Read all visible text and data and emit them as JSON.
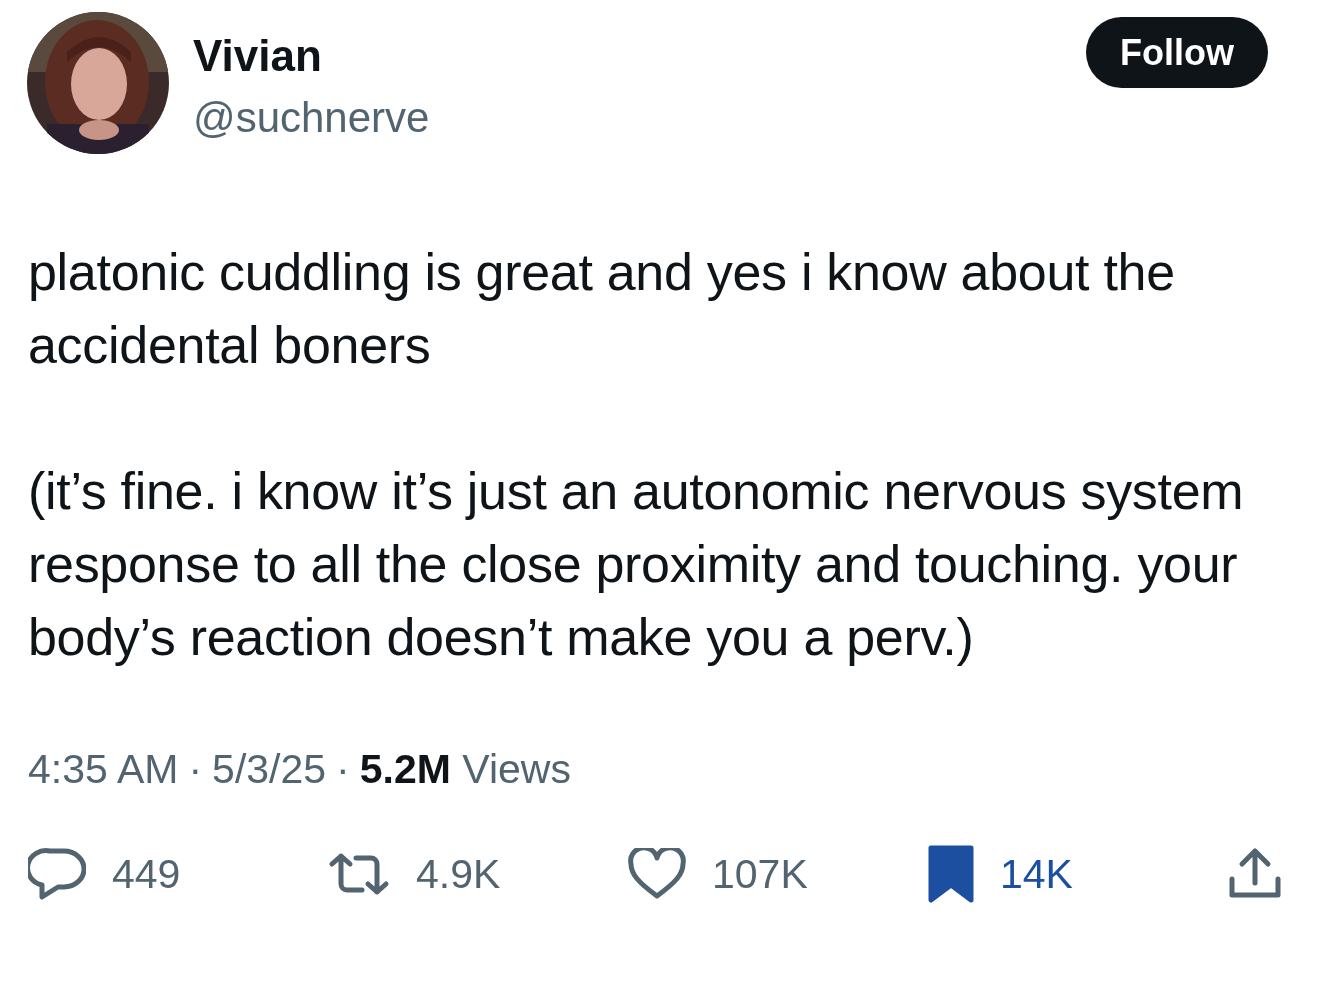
{
  "author": {
    "name": "Vivian",
    "handle": "@suchnerve"
  },
  "follow_button": {
    "label": "Follow"
  },
  "post": {
    "paragraphs": [
      "platonic cuddling is great and yes i know about the accidental boners",
      "(it’s fine. i know it’s just an autonomic nervous system response to all the close proximity and touching. your body’s reaction doesn’t make you a perv.)"
    ]
  },
  "meta": {
    "time": "4:35 AM",
    "separator_1": "·",
    "date": "5/3/25",
    "separator_2": "·",
    "views": "**5.2M** Views"
  },
  "actions": [
    {
      "kind": "reply",
      "count": "449",
      "selected": false
    },
    {
      "kind": "repost",
      "count": "4.9K",
      "selected": false
    },
    {
      "kind": "like",
      "count": "107K",
      "selected": false
    },
    {
      "kind": "bookmark",
      "count": "14K",
      "selected": true
    },
    {
      "kind": "share",
      "selected": false
    }
  ]
}
